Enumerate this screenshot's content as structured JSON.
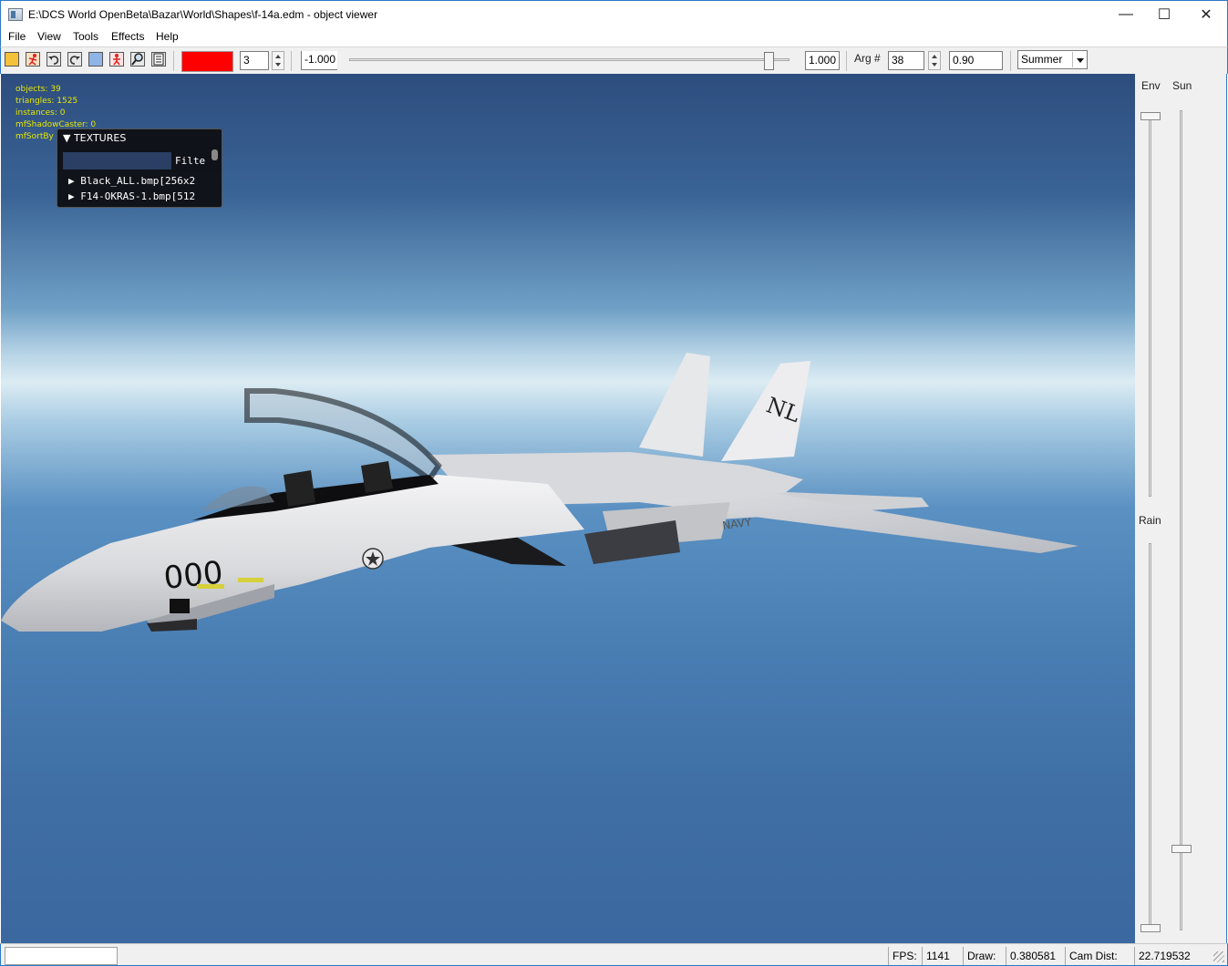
{
  "window": {
    "title": "E:\\DCS World OpenBeta\\Bazar\\World\\Shapes\\f-14a.edm - object viewer",
    "minimize_symbol": "—",
    "maximize_symbol": "☐",
    "close_symbol": "✕"
  },
  "menu": [
    "File",
    "View",
    "Tools",
    "Effects",
    "Help"
  ],
  "toolbar": {
    "icons": [
      "open-folder-icon",
      "run-figure-icon",
      "undo-icon",
      "redo-icon",
      "image-icon",
      "figure-red-icon",
      "zoom-magnifier-icon",
      "document-icon"
    ],
    "color_value": "#ff0000",
    "lod_value": "3",
    "range_min": "-1.000",
    "range_max": "1.000",
    "slider_fraction": 0.94,
    "arg_label": "Arg #",
    "arg_value": "38",
    "arg_amount": "0.90",
    "season": "Summer"
  },
  "stats": {
    "objects": "objects: 39",
    "triangles": "triangles: 1525",
    "instances": "instances: 0",
    "shadow_caster": "mfShadowCaster: 0",
    "sort_by": "mfSortBy"
  },
  "textures_panel": {
    "header": "▼ TEXTURES",
    "filter_label": "Filte",
    "items": [
      "▶ Black_ALL.bmp[256x2",
      "▶ F14-OKRAS-1.bmp[512"
    ]
  },
  "aircraft": {
    "nose_number": "000",
    "tail_code": "NL",
    "service": "NAVY"
  },
  "side_panel": {
    "env_label": "Env",
    "sun_label": "Sun",
    "rain_label": "Rain"
  },
  "statusbar": {
    "fps_label": "FPS:",
    "fps_value": "1141",
    "draw_label": "Draw:",
    "draw_value": "0.380581",
    "camdist_label": "Cam Dist:",
    "camdist_value": "22.719532"
  }
}
